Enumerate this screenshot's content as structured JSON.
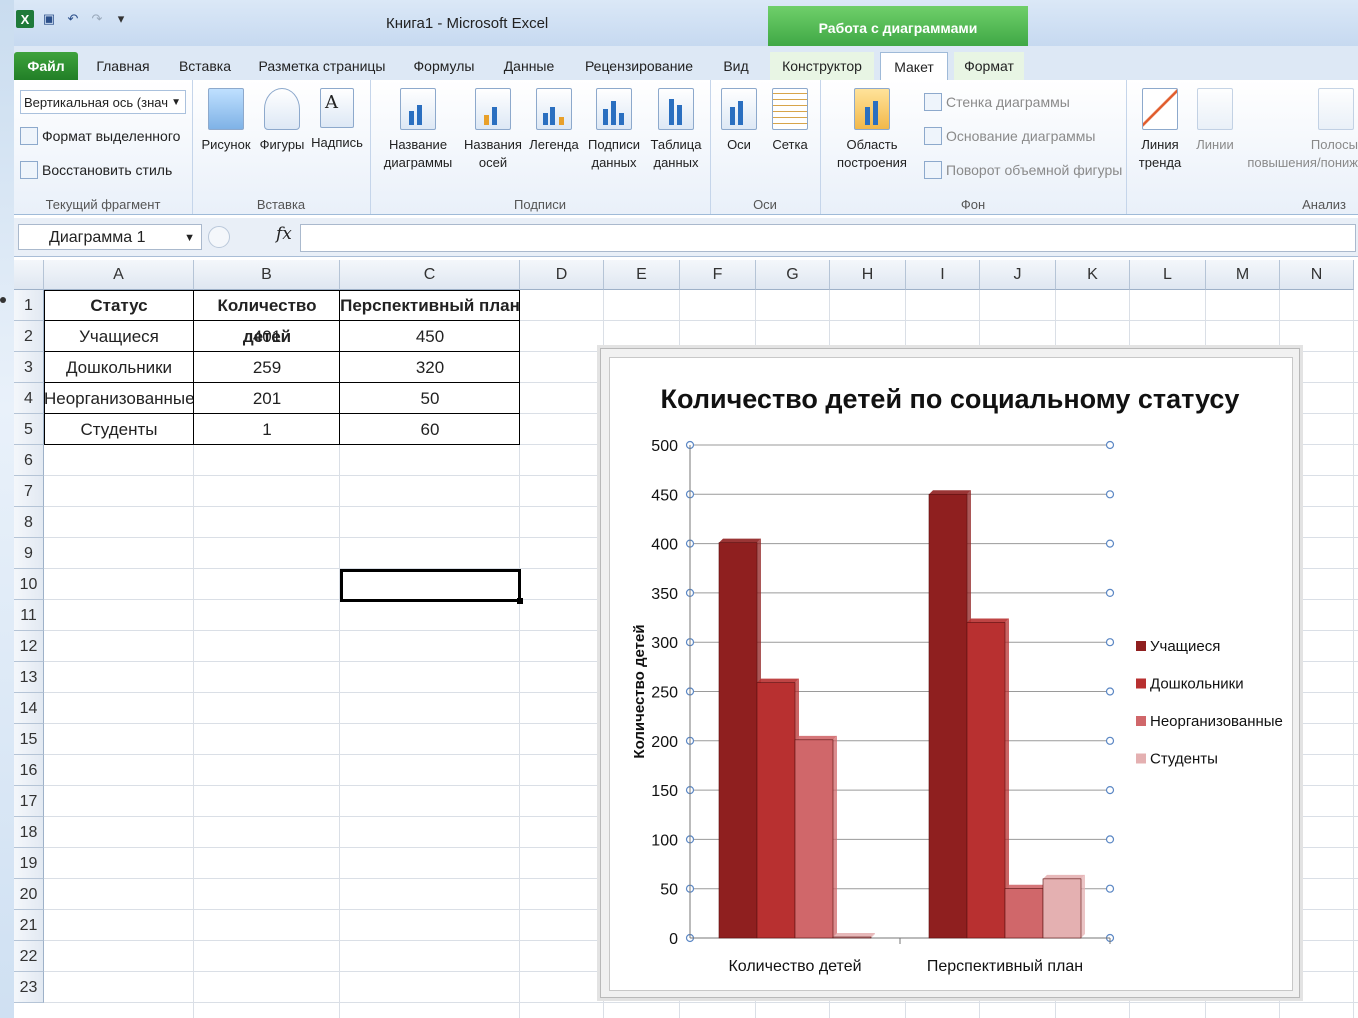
{
  "window": {
    "title": "Книга1  -  Microsoft Excel",
    "context_header": "Работа с диаграммами"
  },
  "tabs": [
    {
      "label": "Файл"
    },
    {
      "label": "Главная"
    },
    {
      "label": "Вставка"
    },
    {
      "label": "Разметка страницы"
    },
    {
      "label": "Формулы"
    },
    {
      "label": "Данные"
    },
    {
      "label": "Рецензирование"
    },
    {
      "label": "Вид"
    },
    {
      "label": "Конструктор"
    },
    {
      "label": "Макет"
    },
    {
      "label": "Формат"
    }
  ],
  "ribbon": {
    "current_fragment": {
      "selector_value": "Вертикальная ось (знач",
      "format_selection": "Формат выделенного",
      "restore_style": "Восстановить стиль",
      "label": "Текущий фрагмент"
    },
    "insert": {
      "picture": "Рисунок",
      "shapes": "Фигуры",
      "textbox": "Надпись",
      "label": "Вставка"
    },
    "labels": {
      "chart_title": "Название диаграммы",
      "axis_titles": "Названия осей",
      "legend": "Легенда",
      "data_labels": "Подписи данных",
      "data_table": "Таблица данных",
      "label": "Подписи"
    },
    "axes": {
      "axes": "Оси",
      "gridlines": "Сетка",
      "label": "Оси"
    },
    "background": {
      "plot_area": "Область построения",
      "chart_wall": "Стенка диаграммы",
      "chart_floor": "Основание диаграммы",
      "rotation_3d": "Поворот объемной фигуры",
      "label": "Фон"
    },
    "analysis": {
      "trendline": "Линия тренда",
      "lines": "Линии",
      "updown_bars": "Полосы повышения/пониж",
      "label": "Анализ"
    }
  },
  "formula_bar": {
    "name_box": "Диаграмма 1",
    "fx": "fx",
    "formula": ""
  },
  "columns": [
    "A",
    "B",
    "C",
    "D",
    "E",
    "F",
    "G",
    "H",
    "I",
    "J",
    "K",
    "L",
    "M",
    "N"
  ],
  "rows": [
    "1",
    "2",
    "3",
    "4",
    "5",
    "6",
    "7",
    "8",
    "9",
    "10",
    "11",
    "12",
    "13",
    "14",
    "15",
    "16",
    "17",
    "18",
    "19",
    "20",
    "21",
    "22",
    "23"
  ],
  "table": {
    "headers": [
      "Статус",
      "Количество детей",
      "Перспективный план"
    ],
    "rows": [
      [
        "Учащиеся",
        "401",
        "450"
      ],
      [
        "Дошкольники",
        "259",
        "320"
      ],
      [
        "Неорганизованные",
        "201",
        "50"
      ],
      [
        "Студенты",
        "1",
        "60"
      ]
    ]
  },
  "chart_data": {
    "type": "bar",
    "title": "Количество детей по социальному статусу",
    "ylabel": "Количество  детей",
    "xlabel": "",
    "categories": [
      "Количество детей",
      "Перспективный план"
    ],
    "series": [
      {
        "name": "Учащиеся",
        "values": [
          401,
          450
        ],
        "color": "#8f1f1f"
      },
      {
        "name": "Дошкольники",
        "values": [
          259,
          320
        ],
        "color": "#b83030"
      },
      {
        "name": "Неорганизованные",
        "values": [
          201,
          50
        ],
        "color": "#d0676a"
      },
      {
        "name": "Студенты",
        "values": [
          1,
          60
        ],
        "color": "#e4b0b1"
      }
    ],
    "ylim": [
      0,
      500
    ],
    "yticks": [
      "0",
      "50",
      "100",
      "150",
      "200",
      "250",
      "300",
      "350",
      "400",
      "450",
      "500"
    ],
    "grid": true,
    "legend": "right"
  }
}
